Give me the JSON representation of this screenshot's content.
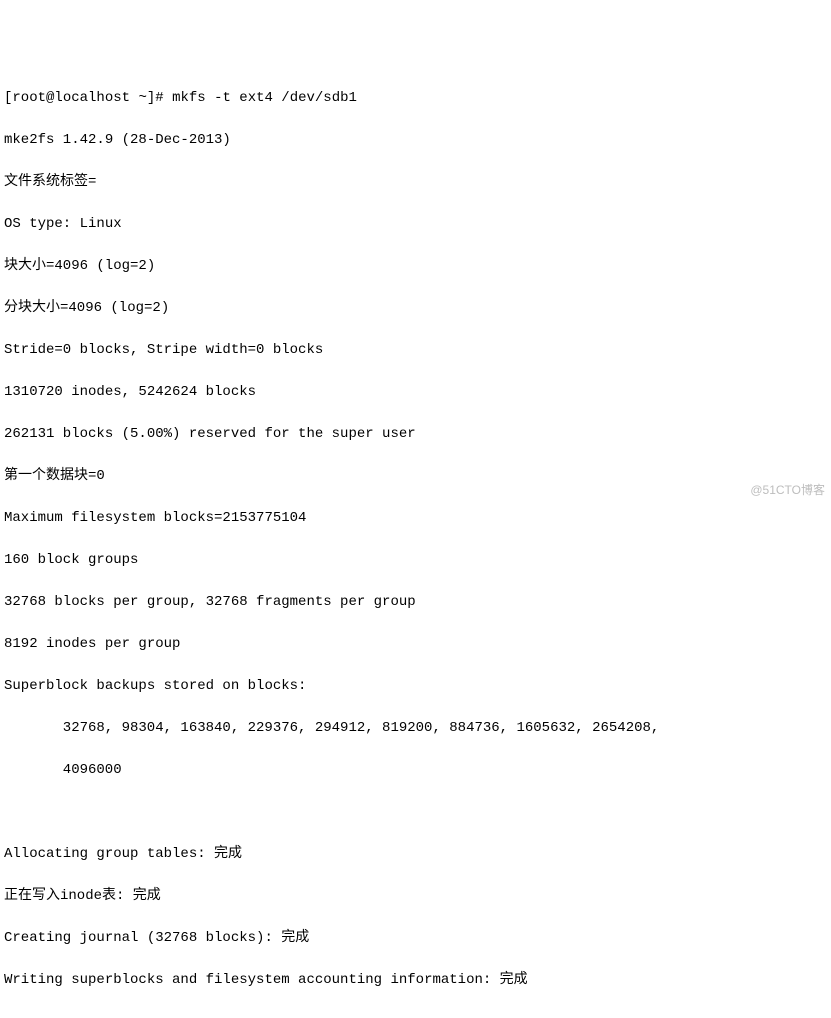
{
  "prompt": {
    "user": "root",
    "host": "localhost",
    "cwd": "~",
    "symbol": "#",
    "command": "mkfs -t ext4 /dev/sdb1"
  },
  "lines": {
    "l1": "mke2fs 1.42.9 (28-Dec-2013)",
    "l2": "文件系统标签=",
    "l3": "OS type: Linux",
    "l4": "块大小=4096 (log=2)",
    "l5": "分块大小=4096 (log=2)",
    "l6": "Stride=0 blocks, Stripe width=0 blocks",
    "l7": "1310720 inodes, 5242624 blocks",
    "l8": "262131 blocks (5.00%) reserved for the super user",
    "l9": "第一个数据块=0",
    "l10": "Maximum filesystem blocks=2153775104",
    "l11": "160 block groups",
    "l12": "32768 blocks per group, 32768 fragments per group",
    "l13": "8192 inodes per group",
    "l14": "Superblock backups stored on blocks:",
    "l15": "32768, 98304, 163840, 229376, 294912, 819200, 884736, 1605632, 2654208,",
    "l16": "4096000",
    "l17": " ",
    "l18": "Allocating group tables: 完成",
    "l19": "正在写入inode表: 完成",
    "l20": "Creating journal (32768 blocks): 完成",
    "l21": "Writing superblocks and filesystem accounting information: 完成"
  },
  "watermark": "@51CTO博客"
}
